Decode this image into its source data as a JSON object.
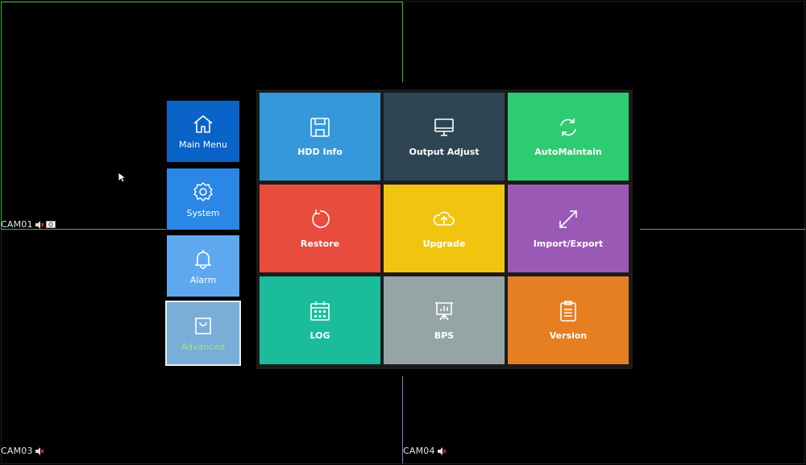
{
  "cameras": {
    "cam1": "CAM01",
    "cam3": "CAM03",
    "cam4": "CAM04"
  },
  "sidebar": {
    "items": [
      {
        "label": "Main Menu",
        "icon": "home-icon",
        "color": "#0a63c8"
      },
      {
        "label": "System",
        "icon": "gear-icon",
        "color": "#2b87e6"
      },
      {
        "label": "Alarm",
        "icon": "bell-icon",
        "color": "#5fa8ef"
      },
      {
        "label": "Advanced",
        "icon": "shopping-bag-icon",
        "color": "#7aaed8",
        "active": true,
        "label_color": "#8ff06a"
      }
    ]
  },
  "tiles": [
    {
      "label": "HDD Info",
      "icon": "floppy-disk-icon",
      "color": "#3498db"
    },
    {
      "label": "Output Adjust",
      "icon": "monitor-icon",
      "color": "#2d4553"
    },
    {
      "label": "AutoMaintain",
      "icon": "refresh-icon",
      "color": "#2ecc71"
    },
    {
      "label": "Restore",
      "icon": "restore-icon",
      "color": "#e74c3c"
    },
    {
      "label": "Upgrade",
      "icon": "cloud-upload-icon",
      "color": "#f1c40f"
    },
    {
      "label": "Import/Export",
      "icon": "expand-arrows-icon",
      "color": "#9b59b6"
    },
    {
      "label": "LOG",
      "icon": "calendar-icon",
      "color": "#1abc9c"
    },
    {
      "label": "BPS",
      "icon": "presentation-chart-icon",
      "color": "#95a5a6"
    },
    {
      "label": "Version",
      "icon": "clipboard-icon",
      "color": "#e67e22"
    }
  ]
}
